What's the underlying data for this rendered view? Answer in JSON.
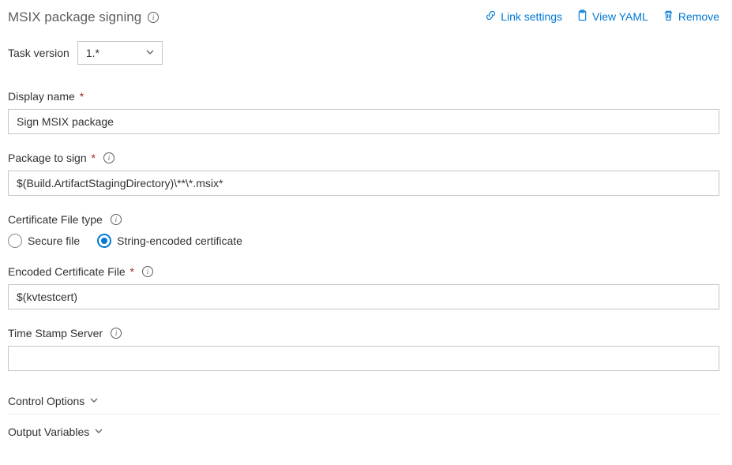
{
  "header": {
    "title": "MSIX package signing",
    "actions": {
      "link_settings": "Link settings",
      "view_yaml": "View YAML",
      "remove": "Remove"
    }
  },
  "task_version": {
    "label": "Task version",
    "value": "1.*"
  },
  "fields": {
    "display_name": {
      "label": "Display name",
      "value": "Sign MSIX package"
    },
    "package_to_sign": {
      "label": "Package to sign",
      "value": "$(Build.ArtifactStagingDirectory)\\**\\*.msix*"
    },
    "cert_file_type": {
      "label": "Certificate File type",
      "options": {
        "secure_file": "Secure file",
        "string_encoded": "String-encoded certificate"
      },
      "selected": "string_encoded"
    },
    "encoded_cert_file": {
      "label": "Encoded Certificate File",
      "value": "$(kvtestcert)"
    },
    "time_stamp_server": {
      "label": "Time Stamp Server",
      "value": ""
    }
  },
  "sections": {
    "control_options": "Control Options",
    "output_variables": "Output Variables"
  }
}
